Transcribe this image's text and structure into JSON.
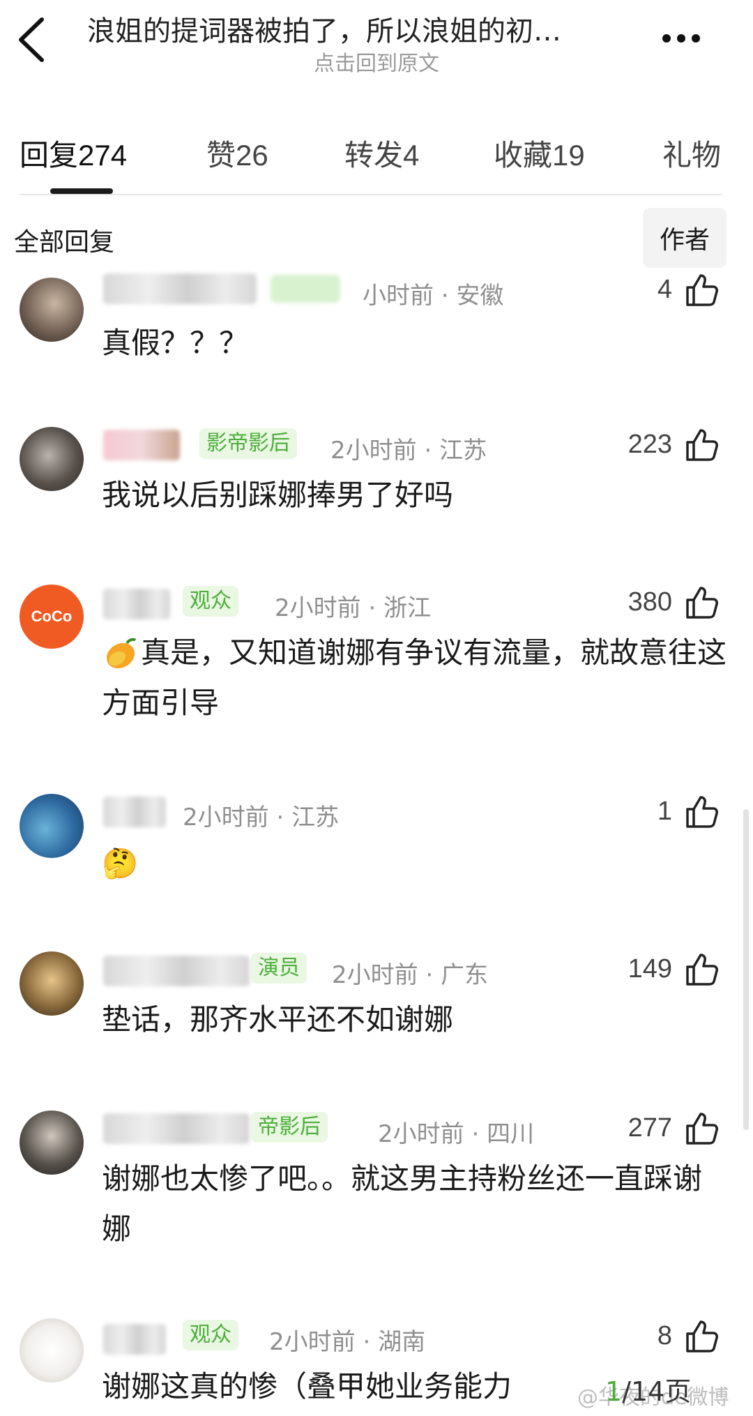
{
  "header": {
    "title": "浪姐的提词器被拍了，所以浪姐的初…",
    "subtitle": "点击回到原文"
  },
  "tabs": [
    {
      "label": "回复",
      "count": "274"
    },
    {
      "label": "赞",
      "count": "26"
    },
    {
      "label": "转发",
      "count": "4"
    },
    {
      "label": "收藏",
      "count": "19"
    },
    {
      "label": "礼物",
      "count": ""
    }
  ],
  "filter": {
    "label": "全部回复",
    "author_chip": "作者"
  },
  "comments": [
    {
      "name": "",
      "badge": "",
      "time": "小时前",
      "location": "安徽",
      "likes": "4",
      "text": "真假？？？"
    },
    {
      "name": "",
      "badge": "影帝影后",
      "time": "2小时前",
      "location": "江苏",
      "likes": "223",
      "text": "我说以后别踩娜捧男了好吗"
    },
    {
      "name": "coco",
      "badge": "观众",
      "time": "2小时前",
      "location": "浙江",
      "likes": "380",
      "text": "真是，又知道谢娜有争议有流量，就故意往这方面引导"
    },
    {
      "name": "",
      "badge": "",
      "time": "2小时前",
      "location": "江苏",
      "likes": "1",
      "text": "🤔"
    },
    {
      "name": "",
      "badge": "演员",
      "time": "2小时前",
      "location": "广东",
      "likes": "149",
      "text": "垫话，那齐水平还不如谢娜"
    },
    {
      "name": "",
      "badge": "帝影后",
      "time": "2小时前",
      "location": "四川",
      "likes": "277",
      "text": "谢娜也太惨了吧。。就这男主持粉丝还一直踩谢娜"
    },
    {
      "name": "",
      "badge": "观众",
      "time": "2小时前",
      "location": "湖南",
      "likes": "8",
      "text": "谢娜这真的惨（叠甲她业务能力"
    }
  ],
  "pagination": {
    "current": "1",
    "total_label": "/14页"
  },
  "watermark": "@华夜的de微博",
  "colors": {
    "badge_green": "#4cae3a",
    "badge_bg": "#e9f7e3",
    "meta_gray": "#8f8f8f"
  },
  "icons": {
    "back": "chevron-left-icon",
    "more": "more-dots-icon",
    "like": "thumbs-up-icon"
  }
}
